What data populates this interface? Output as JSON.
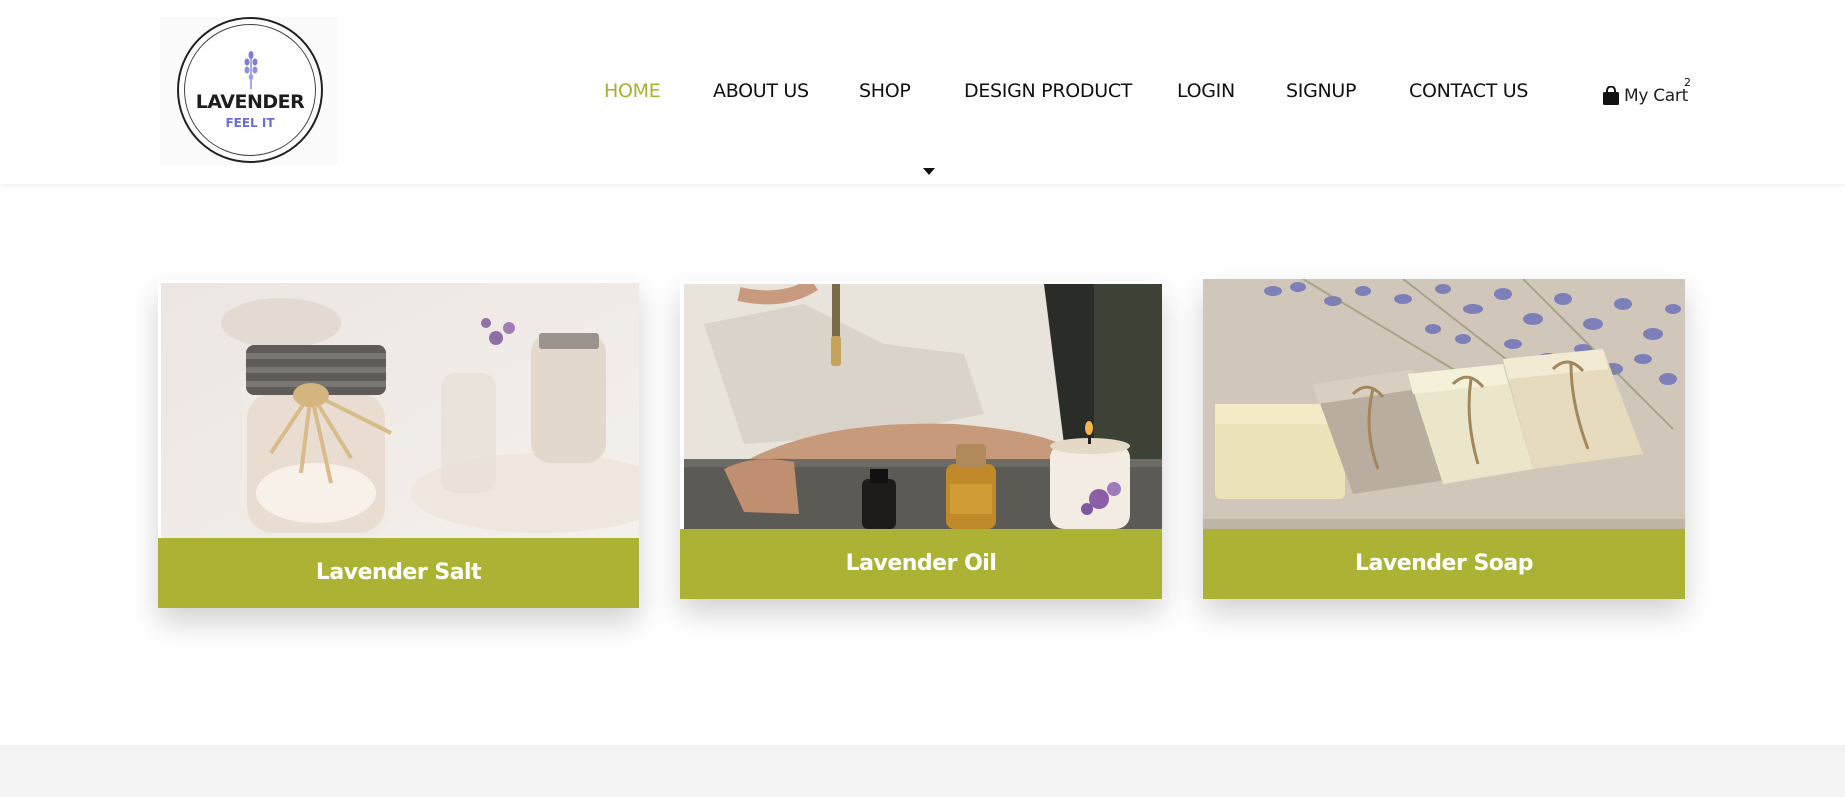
{
  "logo": {
    "name": "LAVENDER",
    "tagline": "FEEL IT"
  },
  "nav": {
    "home": "HOME",
    "about": "ABOUT US",
    "shop": "SHOP",
    "design": "DESIGN PRODUCT",
    "login": "LOGIN",
    "signup": "SIGNUP",
    "contact": "CONTACT US"
  },
  "cart": {
    "label": "My Cart",
    "count": "2"
  },
  "products": [
    {
      "title": "Lavender Salt"
    },
    {
      "title": "Lavender Oil"
    },
    {
      "title": "Lavender Soap"
    }
  ],
  "colors": {
    "accent": "#acb334",
    "active_nav": "#a9b02f",
    "logo_tag": "#6c6ed6"
  }
}
